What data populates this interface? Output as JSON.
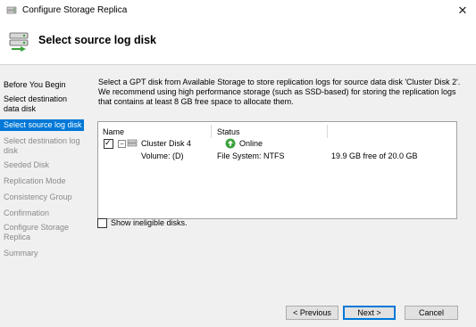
{
  "window": {
    "title": "Configure Storage Replica",
    "close_glyph": "✕"
  },
  "header": {
    "title": "Select source log disk"
  },
  "sidebar": {
    "items": [
      {
        "label": "Before You Begin",
        "state": "done"
      },
      {
        "label": "Select destination data disk",
        "state": "done"
      },
      {
        "label": "Select source log disk",
        "state": "active"
      },
      {
        "label": "Select destination log disk",
        "state": "dim"
      },
      {
        "label": "Seeded Disk",
        "state": "dim"
      },
      {
        "label": "Replication Mode",
        "state": "dim"
      },
      {
        "label": "Consistency Group",
        "state": "dim"
      },
      {
        "label": "Confirmation",
        "state": "dim"
      },
      {
        "label": "Configure Storage Replica",
        "state": "dim"
      },
      {
        "label": "Summary",
        "state": "dim"
      }
    ]
  },
  "main": {
    "description": "Select a GPT disk from Available Storage to store replication logs for source data disk 'Cluster Disk 2'. We recommend using high performance storage (such as SSD-based) for storing the replication logs that contains at least 8 GB free space to allocate them.",
    "columns": {
      "name": "Name",
      "status": "Status"
    },
    "disk": {
      "checked": true,
      "check_glyph": "✓",
      "expander": "−",
      "name": "Cluster Disk 4",
      "status": "Online",
      "volume": "Volume: (D)",
      "filesystem": "File System: NTFS",
      "free": "19.9 GB free of 20.0 GB"
    },
    "show_ineligible": {
      "label": "Show ineligible disks.",
      "checked": false
    }
  },
  "buttons": {
    "previous": "< Previous",
    "next": "Next >",
    "cancel": "Cancel"
  },
  "colors": {
    "accent": "#0078d7",
    "online": "#3aa33a"
  }
}
